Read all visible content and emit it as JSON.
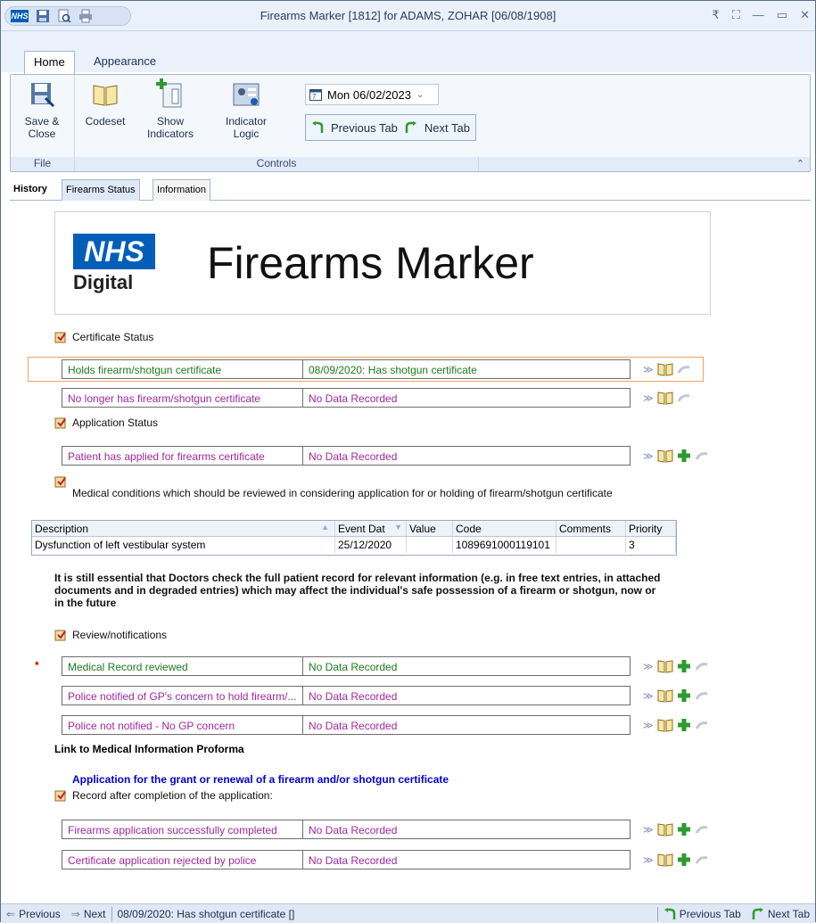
{
  "window": {
    "title": "Firearms Marker [1812] for ADAMS, ZOHAR [06/08/1908]",
    "app_badge": "NHS"
  },
  "ribbon_tabs": [
    "Home",
    "Appearance"
  ],
  "ribbon": {
    "file_group": {
      "label": "File",
      "save_close": "Save &\nClose"
    },
    "controls_group": {
      "label": "Controls",
      "codeset": "Codeset",
      "show_indicators": "Show\nIndicators",
      "indicator_logic": "Indicator\nLogic",
      "date_value": "Mon 06/02/2023",
      "previous_tab": "Previous Tab",
      "next_tab": "Next Tab"
    }
  },
  "content_tabs": [
    "History",
    "Firearms Status",
    "Information"
  ],
  "banner": {
    "logo_text": "NHS",
    "logo_sub": "Digital",
    "title": "Firearms Marker"
  },
  "sections": {
    "certificate_status": "Certificate Status",
    "application_status": "Application Status",
    "medical_conditions": "Medical conditions which should be reviewed in considering application for or holding of firearm/shotgun certificate",
    "review_notifications": "Review/notifications",
    "record_after": "Record after completion of the application:"
  },
  "rows": {
    "holds": {
      "label": "Holds firearm/shotgun certificate",
      "value": "08/09/2020: Has shotgun certificate"
    },
    "no_longer": {
      "label": "No longer has firearm/shotgun certificate",
      "value": "No Data Recorded"
    },
    "applied": {
      "label": "Patient has applied for firearms certificate",
      "value": "No Data Recorded"
    },
    "reviewed": {
      "label": "Medical Record reviewed",
      "value": "No Data Recorded"
    },
    "police_notified": {
      "label": "Police notified of GP's concern to hold firearm/...",
      "value": "No Data Recorded"
    },
    "police_not_notified": {
      "label": "Police not notified - No GP concern",
      "value": "No Data Recorded"
    },
    "app_completed": {
      "label": "Firearms application successfully completed",
      "value": "No Data Recorded"
    },
    "app_rejected": {
      "label": "Certificate application rejected by police",
      "value": "No Data Recorded"
    }
  },
  "grid": {
    "headers": [
      "Description",
      "Event Dat",
      "Value",
      "Code",
      "Comments",
      "Priority"
    ],
    "row": [
      "Dysfunction of left vestibular system",
      "25/12/2020",
      "",
      "1089691000119101",
      "",
      "3"
    ]
  },
  "note": "It is still essential that Doctors check the full patient record for relevant information (e.g. in free text entries, in attached documents and in degraded entries) which may affect the individual's safe possession of a firearm or shotgun, now or in the future",
  "link_label": "Link to Medical Information Proforma",
  "blue_heading": "Application for the grant or renewal of a firearm and/or shotgun certificate",
  "required_marker": "*",
  "statusbar": {
    "previous": "Previous",
    "next": "Next",
    "message": "08/09/2020: Has shotgun certificate []",
    "previous_tab": "Previous Tab",
    "next_tab": "Next Tab"
  },
  "colors": {
    "nhs_blue": "#005eb8",
    "green_label": "#1d7c1d",
    "purple_label": "#a0289c",
    "blue_heading": "#0000d6"
  }
}
